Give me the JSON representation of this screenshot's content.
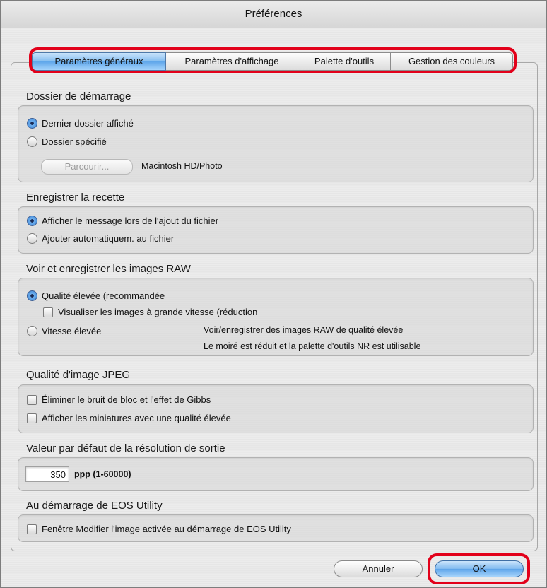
{
  "window": {
    "title": "Préférences"
  },
  "tabs": [
    {
      "label": "Paramètres généraux",
      "active": true
    },
    {
      "label": "Paramètres d'affichage",
      "active": false
    },
    {
      "label": "Palette d'outils",
      "active": false
    },
    {
      "label": "Gestion des couleurs",
      "active": false
    }
  ],
  "startup_folder": {
    "title": "Dossier de démarrage",
    "option_last": "Dernier dossier affiché",
    "option_specified": "Dossier spécifié",
    "browse_label": "Parcourir...",
    "path": "Macintosh HD/Photo",
    "selected": "last"
  },
  "save_recipe": {
    "title": "Enregistrer la recette",
    "option_message": "Afficher le message lors de l'ajout du fichier",
    "option_auto": "Ajouter automatiquem. au fichier",
    "selected": "message"
  },
  "raw": {
    "title": "Voir et enregistrer les images RAW",
    "option_quality": "Qualité élevée (recommandée",
    "option_fast_preview": "Visualiser les images à grande vitesse (réduction",
    "option_speed": "Vitesse élevée",
    "desc_line1": "Voir/enregistrer des images RAW de qualité élevée",
    "desc_line2": "Le moiré est réduit et la palette d'outils NR est utilisable",
    "selected": "quality",
    "fast_preview_checked": false
  },
  "jpeg": {
    "title": "Qualité d'image JPEG",
    "option_noise": "Éliminer le bruit de bloc et l'effet de Gibbs",
    "option_thumbs": "Afficher les miniatures avec une qualité élevée",
    "noise_checked": false,
    "thumbs_checked": false
  },
  "resolution": {
    "title": "Valeur par défaut de la résolution de sortie",
    "value": "350",
    "unit_label": "ppp (1-60000)"
  },
  "eos": {
    "title": "Au démarrage de EOS Utility",
    "option_window": "Fenêtre Modifier l'image activée au démarrage de EOS Utility",
    "window_checked": false
  },
  "footer": {
    "cancel_label": "Annuler",
    "ok_label": "OK"
  },
  "colors": {
    "highlight": "#e2001a",
    "accent_blue": "#5fa6ea"
  }
}
